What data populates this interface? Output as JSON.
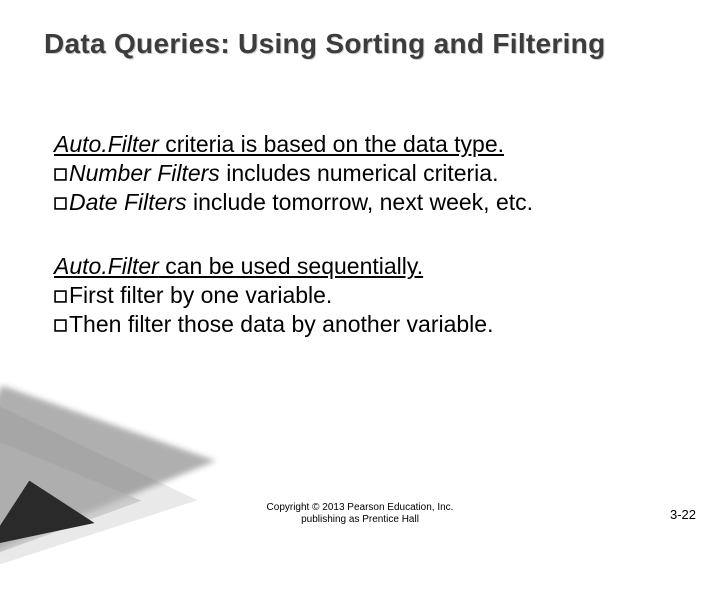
{
  "title": "Data Queries: Using Sorting and Filtering",
  "section1": {
    "heading_italic": "Auto.Filter",
    "heading_rest": " criteria is based on the data type.",
    "b1_italic": "Number Filters",
    "b1_rest": " includes numerical criteria.",
    "b2_italic": "Date Filters",
    "b2_rest": " include tomorrow, next week, etc."
  },
  "section2": {
    "heading_italic": "Auto.Filter",
    "heading_rest": " can be used sequentially.",
    "b1": "First filter by one variable.",
    "b2": "Then filter those data by another variable."
  },
  "copyright_line1": "Copyright © 2013 Pearson Education, Inc.",
  "copyright_line2": "publishing as Prentice Hall",
  "page_number": "3-22"
}
